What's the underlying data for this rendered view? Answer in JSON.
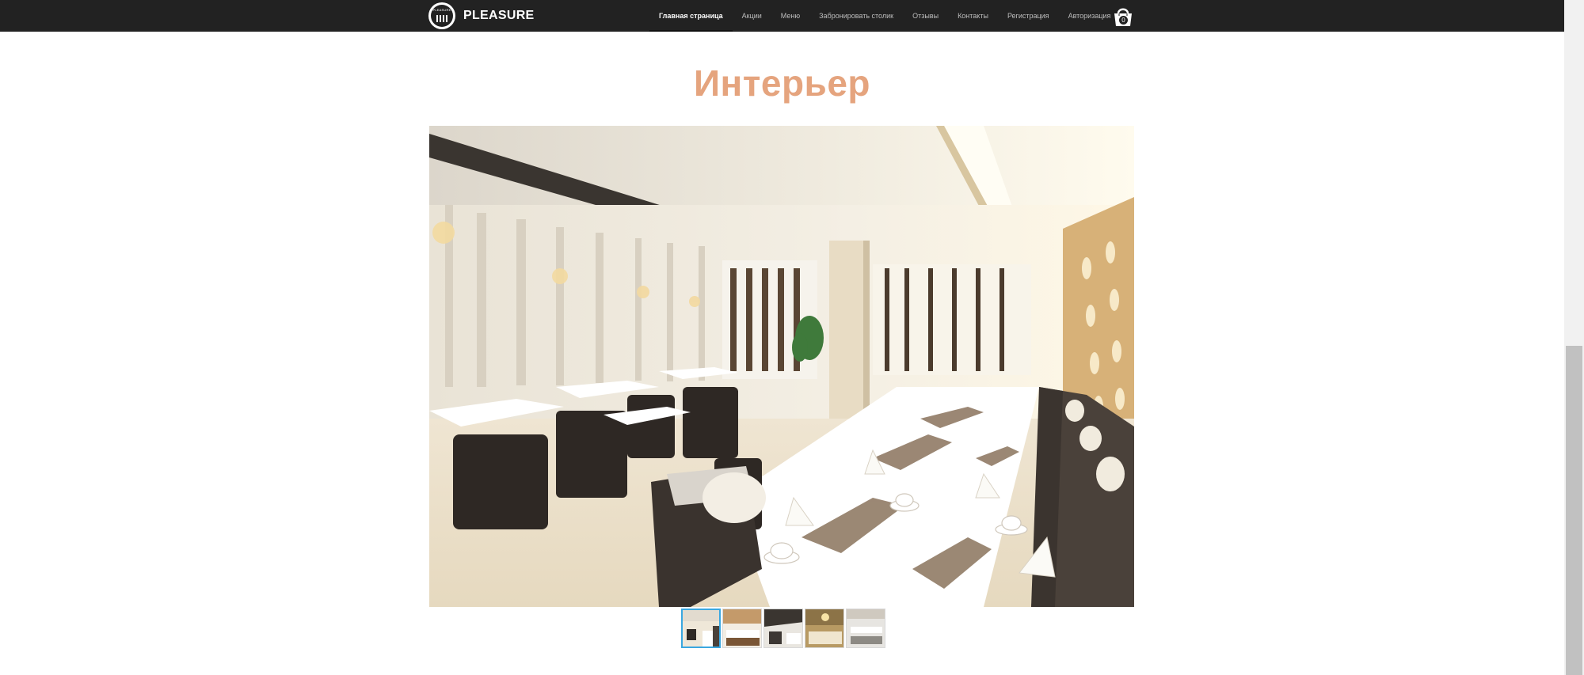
{
  "brand": {
    "name": "PLEASURE",
    "badge_text": "PLEASURE"
  },
  "nav": {
    "items": [
      {
        "label": "Главная страница",
        "active": true
      },
      {
        "label": "Акции",
        "active": false
      },
      {
        "label": "Меню",
        "active": false
      },
      {
        "label": "Забронировать столик",
        "active": false
      },
      {
        "label": "Отзывы",
        "active": false
      },
      {
        "label": "Контакты",
        "active": false
      },
      {
        "label": "Регистрация",
        "active": false
      },
      {
        "label": "Авторизация",
        "active": false
      }
    ]
  },
  "cart": {
    "icon": "basket-icon",
    "count": "0"
  },
  "section": {
    "title": "Интерьер"
  },
  "gallery": {
    "main_image": "restaurant-interior-photo",
    "thumbnails": [
      {
        "name": "thumb-1",
        "selected": true
      },
      {
        "name": "thumb-2",
        "selected": false
      },
      {
        "name": "thumb-3",
        "selected": false
      },
      {
        "name": "thumb-4",
        "selected": false
      },
      {
        "name": "thumb-5",
        "selected": false
      }
    ]
  },
  "colors": {
    "topbar": "#222222",
    "title": "#e5a47e",
    "thumb_selected_border": "#3aa7e0"
  }
}
